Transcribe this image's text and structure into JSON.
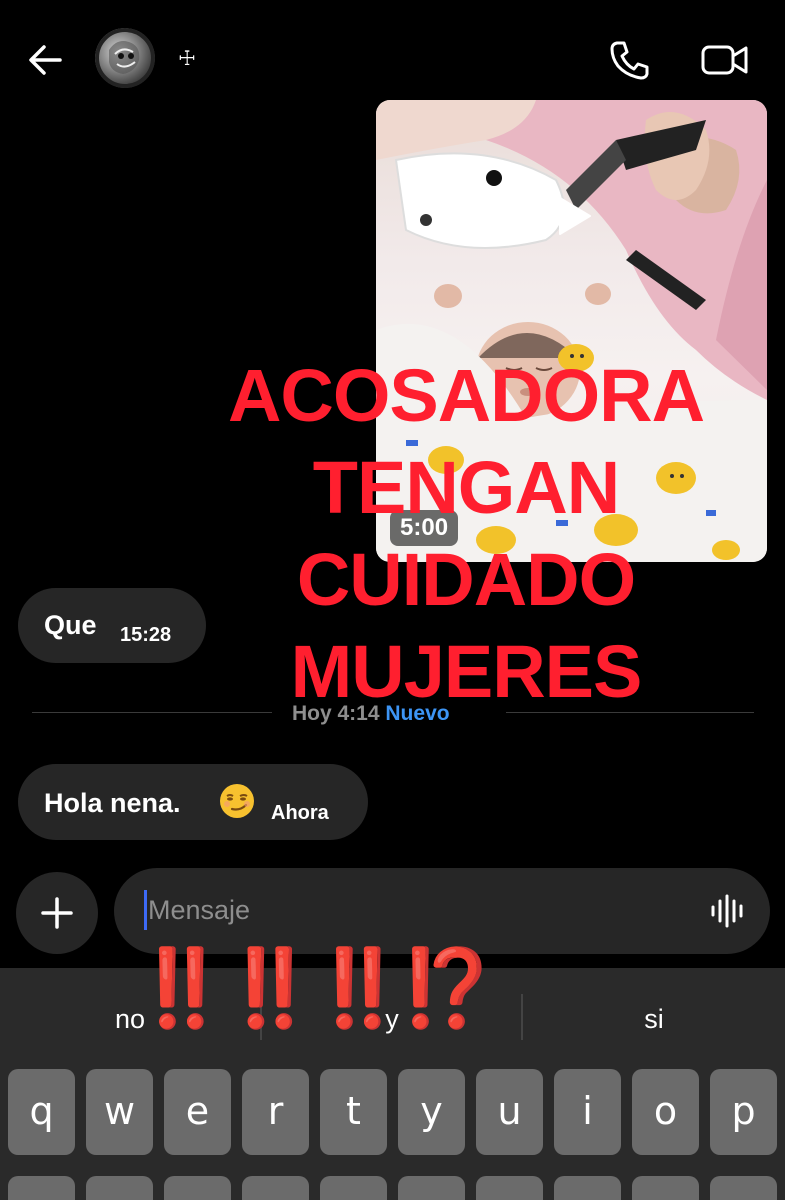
{
  "header": {
    "back_icon": "arrow-left-icon",
    "contact_name": "☩",
    "call_icon": "phone-icon",
    "video_icon": "video-camera-icon"
  },
  "video_message": {
    "duration": "5:00",
    "play_icon": "play-icon"
  },
  "messages": [
    {
      "text": "Que",
      "time": "15:28"
    },
    {
      "text": "Hola nena.",
      "emoji": "smirk-emoji",
      "time": "Ahora"
    }
  ],
  "divider": {
    "date": "Hoy 4:14",
    "badge": "Nuevo"
  },
  "overlay_text": {
    "lines": [
      "ACOSADORA",
      "TENGAN",
      "CUIDADO",
      "MUJERES"
    ],
    "exclaim": "‼️‼️‼️⁉️"
  },
  "composer": {
    "placeholder": "Mensaje",
    "plus_icon": "plus-icon",
    "mic_icon": "voice-wave-icon"
  },
  "keyboard": {
    "suggestions": [
      "no",
      "y",
      "si"
    ],
    "row1": [
      "q",
      "w",
      "e",
      "r",
      "t",
      "y",
      "u",
      "i",
      "o",
      "p"
    ]
  },
  "colors": {
    "background": "#000000",
    "bubble": "#262626",
    "accent_blue": "#3d95f5",
    "overlay_red": "#ff1f2f"
  }
}
